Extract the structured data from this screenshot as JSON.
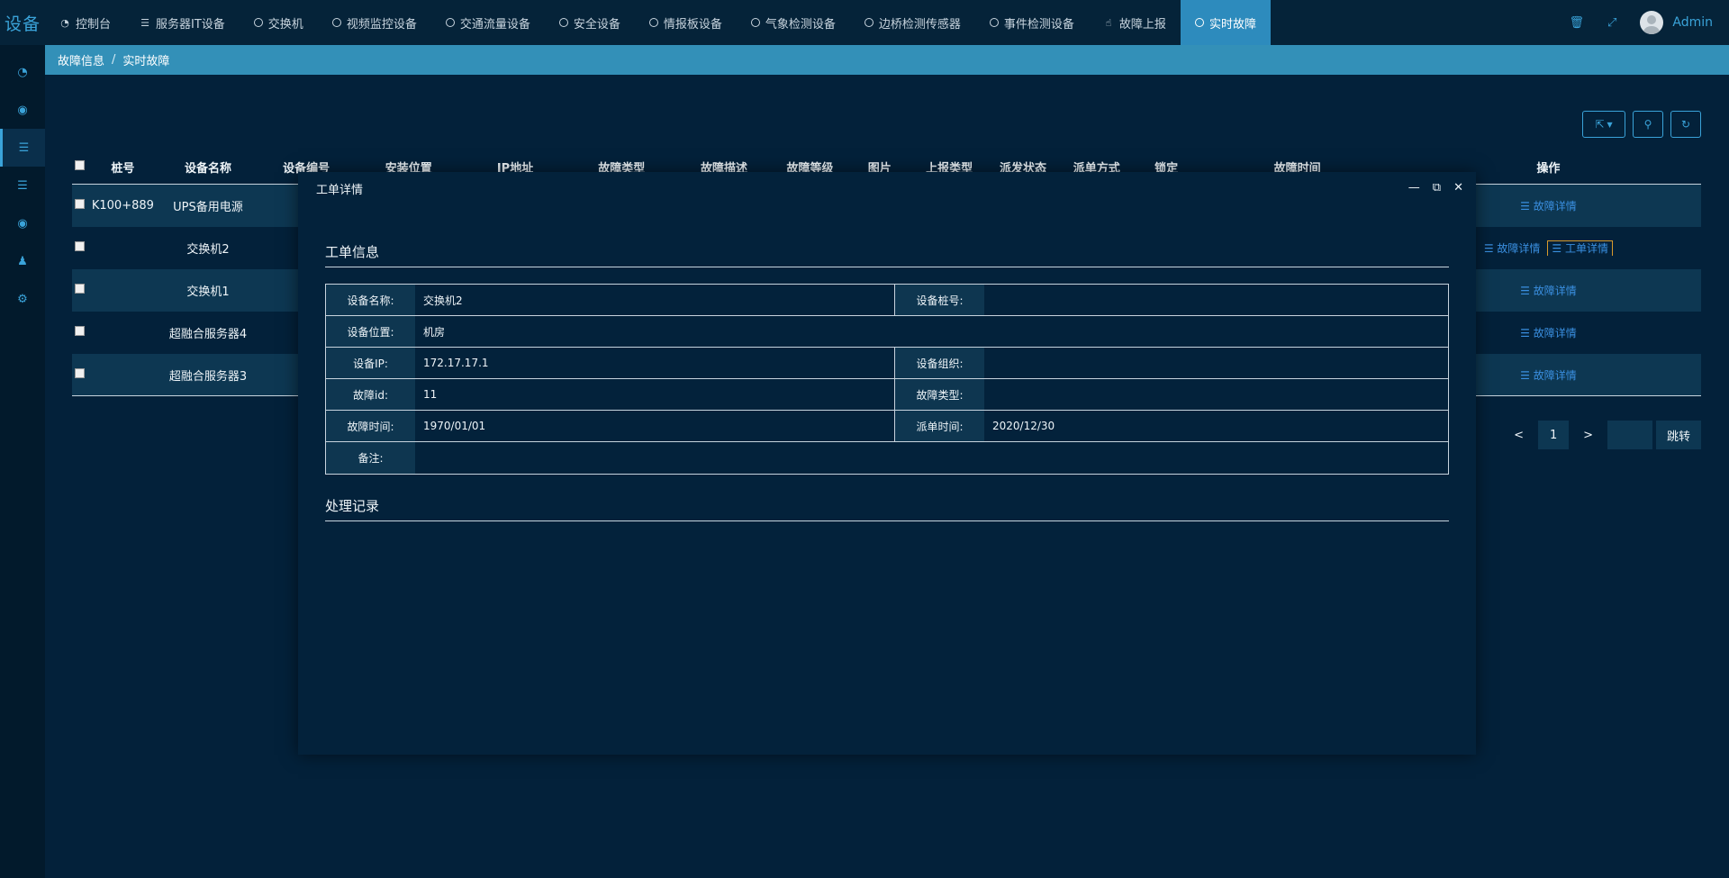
{
  "brand": "设备",
  "nav": [
    {
      "label": "控制台",
      "icon": "dashboard-icon",
      "active": false
    },
    {
      "label": "服务器IT设备",
      "icon": "server-icon",
      "active": false
    },
    {
      "label": "交换机",
      "icon": "circle-icon",
      "active": false
    },
    {
      "label": "视频监控设备",
      "icon": "circle-icon",
      "active": false
    },
    {
      "label": "交通流量设备",
      "icon": "circle-icon",
      "active": false
    },
    {
      "label": "安全设备",
      "icon": "circle-icon",
      "active": false
    },
    {
      "label": "情报板设备",
      "icon": "circle-icon",
      "active": false
    },
    {
      "label": "气象检测设备",
      "icon": "circle-icon",
      "active": false
    },
    {
      "label": "边桥检测传感器",
      "icon": "circle-icon",
      "active": false
    },
    {
      "label": "事件检测设备",
      "icon": "circle-icon",
      "active": false
    },
    {
      "label": "故障上报",
      "icon": "hand-pointer-icon",
      "active": false
    },
    {
      "label": "实时故障",
      "icon": "circle-icon",
      "active": true
    }
  ],
  "user": {
    "name": "Admin"
  },
  "sidebar": [
    {
      "icon": "dashboard-icon",
      "active": false
    },
    {
      "icon": "eye-icon",
      "active": false
    },
    {
      "icon": "list-icon",
      "active": true
    },
    {
      "icon": "list-icon",
      "active": false
    },
    {
      "icon": "eye-icon",
      "active": false
    },
    {
      "icon": "users-icon",
      "active": false
    },
    {
      "icon": "cogs-icon",
      "active": false
    }
  ],
  "breadcrumb": {
    "parent": "故障信息",
    "separator": "/",
    "current": "实时故障"
  },
  "table": {
    "headers": [
      "桩号",
      "设备名称",
      "设备编号",
      "安装位置",
      "IP地址",
      "故障类型",
      "故障描述",
      "故障等级",
      "图片",
      "上报类型",
      "派发状态",
      "派单方式",
      "锁定",
      "故障时间",
      "操作"
    ],
    "rows": [
      {
        "stake": "K100+889",
        "name": "UPS备用电源",
        "ops": [
          "故障详情"
        ]
      },
      {
        "stake": "",
        "name": "交换机2",
        "ops": [
          "故障详情",
          "工单详情"
        ]
      },
      {
        "stake": "",
        "name": "交换机1",
        "ops": [
          "故障详情"
        ]
      },
      {
        "stake": "",
        "name": "超融合服务器4",
        "ops": [
          "故障详情"
        ]
      },
      {
        "stake": "",
        "name": "超融合服务器3",
        "ops": [
          "故障详情"
        ]
      }
    ]
  },
  "pager": {
    "prev": "<",
    "current": "1",
    "next": ">",
    "jump": "跳转"
  },
  "modal": {
    "title": "工单详情",
    "section1": "工单信息",
    "section2": "处理记录",
    "fields": {
      "device_name_label": "设备名称:",
      "device_name": "交换机2",
      "stake_label": "设备桩号:",
      "stake": "",
      "location_label": "设备位置:",
      "location": "机房",
      "ip_label": "设备IP:",
      "ip": "172.17.17.1",
      "org_label": "设备组织:",
      "org": "",
      "fault_id_label": "故障id:",
      "fault_id": "11",
      "fault_type_label": "故障类型:",
      "fault_type": "",
      "fault_time_label": "故障时间:",
      "fault_time": "1970/01/01",
      "dispatch_time_label": "派单时间:",
      "dispatch_time": "2020/12/30",
      "remark_label": "备注:",
      "remark": ""
    }
  }
}
